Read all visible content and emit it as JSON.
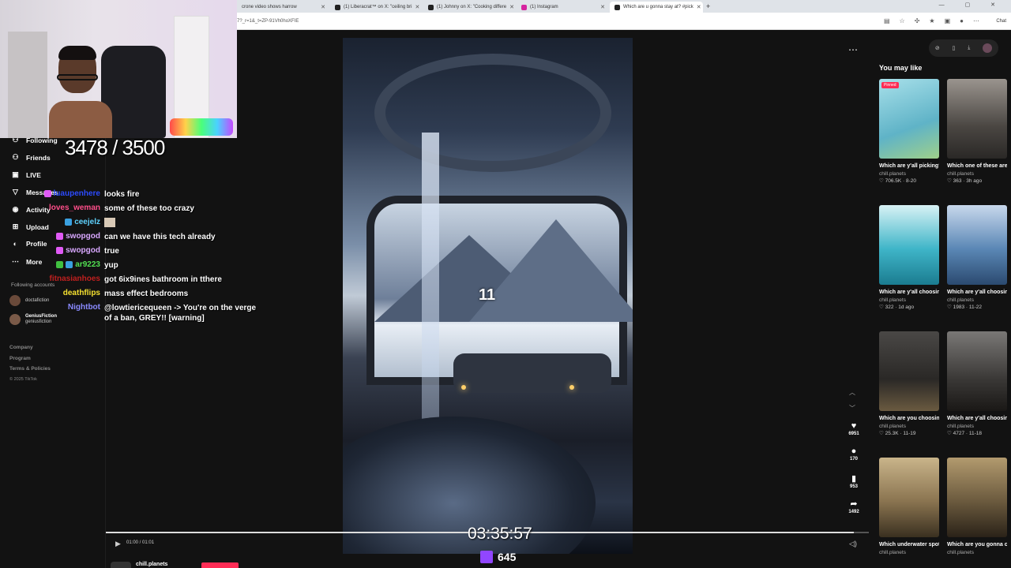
{
  "browser": {
    "tabs": [
      {
        "label": "crone video shows harrow",
        "icon": "none"
      },
      {
        "label": "(1) Liberacrat™ on X: \"ceiling bri",
        "icon": "x-logo-icon"
      },
      {
        "label": "(1) Johnny on X: \"Cooking differe",
        "icon": "x-logo-icon"
      },
      {
        "label": "(1) Instagram",
        "icon": "instagram-icon"
      },
      {
        "label": "Which are u gonna stay at? #pick",
        "icon": "tiktok-icon",
        "active": true
      }
    ],
    "new_tab": "+",
    "url": "7?_r=1&_t=ZP-91Vh0hoXFIE",
    "chat_button": "Chat"
  },
  "nav": {
    "items": [
      {
        "label": "Following",
        "icon": "following-icon"
      },
      {
        "label": "Friends",
        "icon": "friends-icon"
      },
      {
        "label": "LIVE",
        "icon": "live-icon"
      },
      {
        "label": "Messages",
        "icon": "messages-icon"
      },
      {
        "label": "Activity",
        "icon": "activity-icon"
      },
      {
        "label": "Upload",
        "icon": "upload-icon"
      },
      {
        "label": "Profile",
        "icon": "profile-icon"
      },
      {
        "label": "More",
        "icon": "more-icon"
      }
    ],
    "following_title": "Following accounts",
    "accounts": [
      {
        "name": "doctafiction",
        "handle": "doctafiction"
      },
      {
        "name": "GeniusFiction",
        "handle": "geniusfiction"
      }
    ],
    "footer": [
      "Company",
      "Program",
      "Terms & Policies"
    ],
    "copyright": "© 2025 TikTok"
  },
  "stream": {
    "counter": "3478 / 3500",
    "uptime": "03:35:57",
    "viewers": "645",
    "chat": [
      {
        "user": "luaupenhere",
        "color": "#2c4bff",
        "message": "looks fire",
        "badge": "pink"
      },
      {
        "user": "loves_weman",
        "color": "#ff4e8a",
        "message": "some of these too crazy",
        "badge": "none"
      },
      {
        "user": "ceejelz",
        "color": "#5fd3ff",
        "message": "",
        "badge": "blue",
        "emote": true
      },
      {
        "user": "swopgod",
        "color": "#d9a8ff",
        "message": "can we have this tech already",
        "badge": "pink"
      },
      {
        "user": "swopgod",
        "color": "#d9a8ff",
        "message": "true",
        "badge": "pink"
      },
      {
        "user": "ar9223",
        "color": "#52e052",
        "message": "yup",
        "badge": "green"
      },
      {
        "user": "fitnasianhoes",
        "color": "#c0201f",
        "message": "got 6ix9ines bathroom in tthere",
        "badge": "none"
      },
      {
        "user": "deathflips",
        "color": "#f5e030",
        "message": "mass effect bedrooms",
        "badge": "none"
      },
      {
        "user": "Nightbot",
        "color": "#8a8aff",
        "message": "@lowtiericequeen -> You're on the verge of a ban, GREY!! [warning]",
        "badge": "none"
      }
    ]
  },
  "video": {
    "overlay_number": "11",
    "time": "01:00 / 01:01",
    "author": "chill.planets",
    "progress": 0.98
  },
  "actions": [
    {
      "name": "like",
      "icon": "heart-icon",
      "count": "6951"
    },
    {
      "name": "comment",
      "icon": "comment-icon",
      "count": "170"
    },
    {
      "name": "bookmark",
      "icon": "bookmark-icon",
      "count": "953"
    },
    {
      "name": "share",
      "icon": "share-icon",
      "count": "1492"
    }
  ],
  "recommendations": {
    "title": "You may like",
    "pinned_label": "Pinned",
    "cards": [
      {
        "title": "Which are y'all picking? 🧚 #pickon...",
        "author": "chill.planets",
        "meta": "♡ 706.5K · 8-20",
        "pinned": true,
        "color": "#7fc6d8"
      },
      {
        "title": "Which one of these are y'all choosing?...",
        "author": "chill.planets",
        "meta": "♡ 363 · 3h ago",
        "color": "#6e6a66"
      },
      {
        "title": "Which are y'all choosing? 🧚 #pick...",
        "author": "chill.planets",
        "meta": "♡ 322 · 1d ago",
        "color": "#3fb5c8"
      },
      {
        "title": "Which are y'all choosing? #pickon...",
        "author": "chill.planets",
        "meta": "♡ 1983 · 11-22",
        "color": "#5a87b5"
      },
      {
        "title": "Which are you choosing? #pickon...",
        "author": "chill.planets",
        "meta": "♡ 25.3K · 11-19",
        "color": "#3a3836"
      },
      {
        "title": "Which are y'all choosing? #pickon...",
        "author": "chill.planets",
        "meta": "♡ 4727 · 11-18",
        "color": "#4a4846"
      },
      {
        "title": "Which underwater spot u choosing?...",
        "author": "chill.planets",
        "meta": "",
        "color": "#8a7450"
      },
      {
        "title": "Which are you gonna choose? #pickone...",
        "author": "chill.planets",
        "meta": "",
        "color": "#6b5a3e"
      }
    ]
  }
}
